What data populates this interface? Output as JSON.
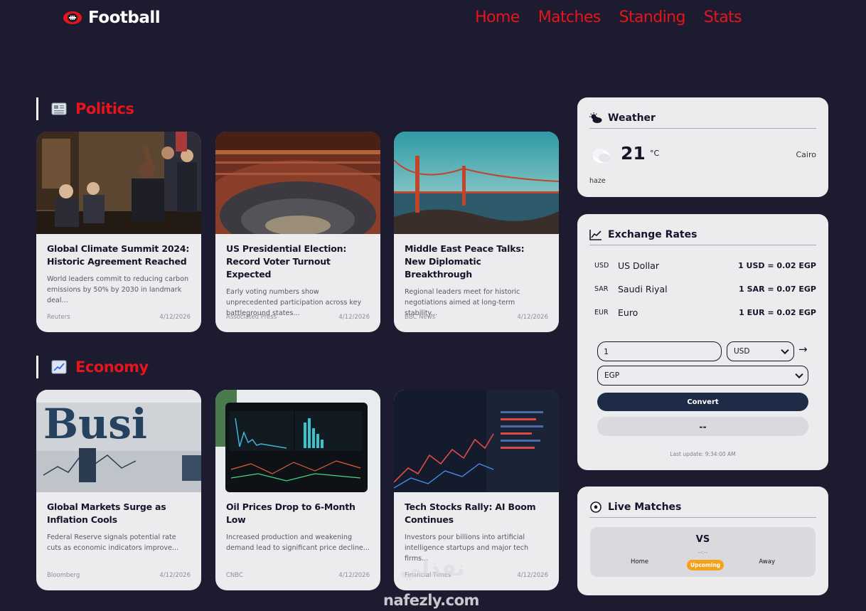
{
  "nav": {
    "brand": "Football",
    "brand_icon": "football-icon",
    "links": [
      "Home",
      "Matches",
      "Standing",
      "Stats"
    ],
    "link_color": "#e8141b"
  },
  "sections": {
    "politics": {
      "title": "Politics",
      "icon": "newspaper-icon",
      "articles": [
        {
          "title": "Global Climate Summit 2024: Historic Agreement Reached",
          "summary": "World leaders commit to reducing carbon emissions by 50% by 2030 in landmark deal...",
          "source": "Reuters",
          "date": "4/12/2026"
        },
        {
          "title": "US Presidential Election: Record Voter Turnout Expected",
          "summary": "Early voting numbers show unprecedented participation across key battleground states...",
          "source": "Associated Press",
          "date": "4/12/2026"
        },
        {
          "title": "Middle East Peace Talks: New Diplomatic Breakthrough",
          "summary": "Regional leaders meet for historic negotiations aimed at long-term stability...",
          "source": "BBC News",
          "date": "4/12/2026"
        }
      ]
    },
    "economy": {
      "title": "Economy",
      "icon": "chart-up-icon",
      "articles": [
        {
          "title": "Global Markets Surge as Inflation Cools",
          "summary": "Federal Reserve signals potential rate cuts as economic indicators improve...",
          "source": "Bloomberg",
          "date": "4/12/2026"
        },
        {
          "title": "Oil Prices Drop to 6-Month Low",
          "summary": "Increased production and weakening demand lead to significant price decline...",
          "source": "CNBC",
          "date": "4/12/2026"
        },
        {
          "title": "Tech Stocks Rally: AI Boom Continues",
          "summary": "Investors pour billions into artificial intelligence startups and major tech firms...",
          "source": "Financial Times",
          "date": "4/12/2026"
        }
      ]
    }
  },
  "weather": {
    "title": "Weather",
    "icon": "sun-cloud-icon",
    "temp": "21",
    "unit": "°C",
    "city": "Cairo",
    "description": "haze",
    "condition_icon": "haze-icon"
  },
  "exchange": {
    "title": "Exchange Rates",
    "icon": "line-chart-icon",
    "rates": [
      {
        "code": "USD",
        "name": "US Dollar",
        "value": "1 USD = 0.02 EGP"
      },
      {
        "code": "SAR",
        "name": "Saudi Riyal",
        "value": "1 SAR = 0.07 EGP"
      },
      {
        "code": "EUR",
        "name": "Euro",
        "value": "1 EUR = 0.02 EGP"
      }
    ],
    "amount": "1",
    "from_currency": "USD",
    "to_currency": "EGP",
    "arrow": "→",
    "convert_label": "Convert",
    "result": "--",
    "last_update": "Last update: 9:34:00 AM"
  },
  "live_matches": {
    "title": "Live Matches",
    "icon": "soccer-ball-icon",
    "match": {
      "vs": "VS",
      "time": "--:--",
      "home": "Home",
      "away": "Away",
      "status": "Upcoming",
      "status_color": "#f5a11a"
    }
  },
  "watermark": {
    "arabic": "نفذلي",
    "latin": "nafezly.com"
  }
}
